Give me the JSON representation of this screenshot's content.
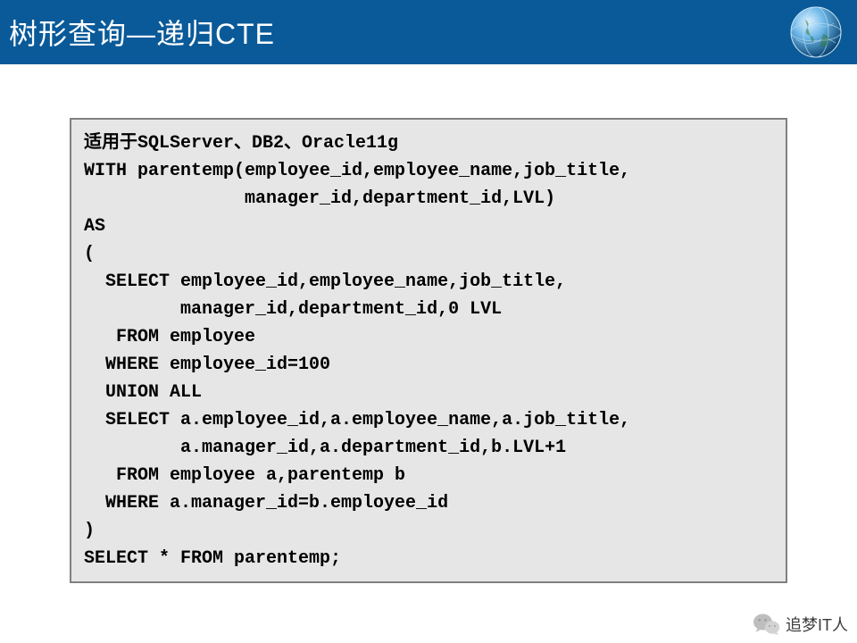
{
  "header": {
    "title": "树形查询—递归CTE"
  },
  "code": {
    "note_prefix": "适用于",
    "note_dbs": "SQLServer、DB2、Oracle11g",
    "lines": [
      "WITH parentemp(employee_id,employee_name,job_title,",
      "               manager_id,department_id,LVL)",
      "AS",
      "(",
      "  SELECT employee_id,employee_name,job_title,",
      "         manager_id,department_id,0 LVL",
      "   FROM employee",
      "  WHERE employee_id=100",
      "  UNION ALL",
      "  SELECT a.employee_id,a.employee_name,a.job_title,",
      "         a.manager_id,a.department_id,b.LVL+1",
      "   FROM employee a,parentemp b",
      "  WHERE a.manager_id=b.employee_id",
      ")",
      "SELECT * FROM parentemp;"
    ]
  },
  "footer": {
    "brand": "追梦IT人"
  }
}
